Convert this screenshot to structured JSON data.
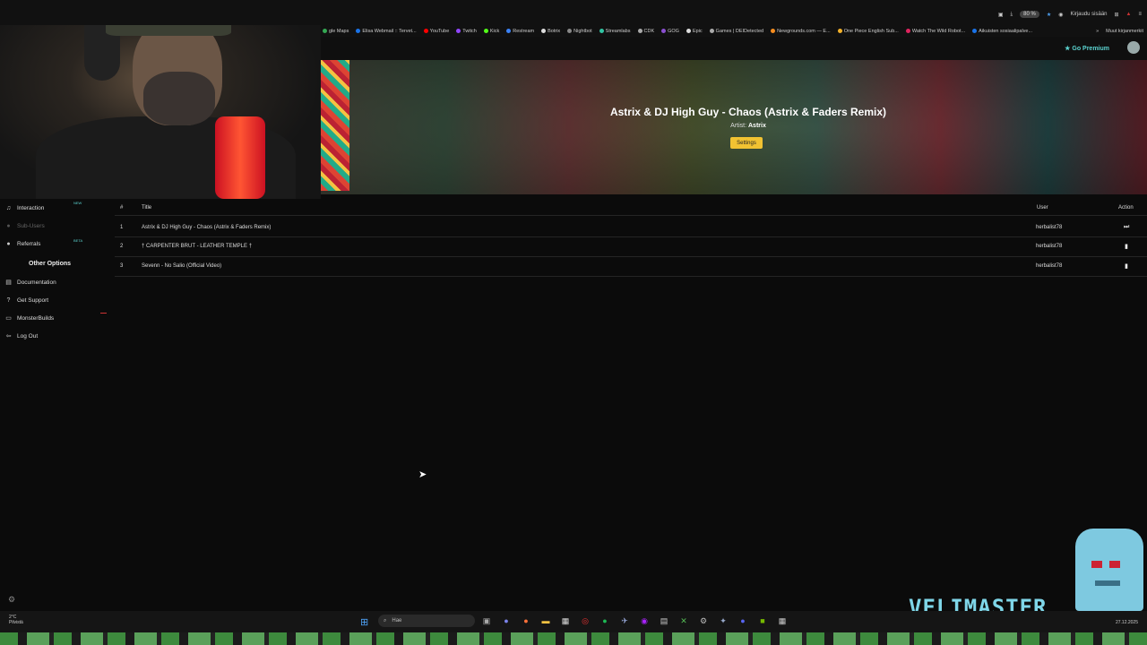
{
  "browser": {
    "zoom": "80 %",
    "signin": "Kirjaudu sisään",
    "bookmarks": [
      {
        "label": "gle Maps",
        "color": "#34a853"
      },
      {
        "label": "Elisa Webmail :: Tervet...",
        "color": "#1a73e8"
      },
      {
        "label": "YouTube",
        "color": "#ff0000"
      },
      {
        "label": "Twitch",
        "color": "#9146ff"
      },
      {
        "label": "Kick",
        "color": "#53fc18"
      },
      {
        "label": "Restream",
        "color": "#3b82f6"
      },
      {
        "label": "Botrix",
        "color": "#ddd"
      },
      {
        "label": "Nightbot",
        "color": "#888"
      },
      {
        "label": "Streamlabs",
        "color": "#31c3a2"
      },
      {
        "label": "CDK",
        "color": "#aaa"
      },
      {
        "label": "GOG",
        "color": "#8a4fd0"
      },
      {
        "label": "Epic",
        "color": "#ddd"
      },
      {
        "label": "Games | DEIDetected",
        "color": "#aaa"
      },
      {
        "label": "Newgrounds.com — E...",
        "color": "#f68d1f"
      },
      {
        "label": "One Piece English Sub...",
        "color": "#f3b12a"
      },
      {
        "label": "Watch The Wild Robot...",
        "color": "#e0245e"
      },
      {
        "label": "Aikuisten sosiaalipalve...",
        "color": "#1a73e8"
      }
    ],
    "other_bookmarks": "Muut kirjanmerkit"
  },
  "appbar": {
    "premium_label": "Go Premium"
  },
  "banner": {
    "song_title": "Astrix & DJ High Guy - Chaos (Astrix & Faders Remix)",
    "artist_label": "Artist:",
    "artist_name": "Astrix",
    "settings_label": "Settings"
  },
  "sidebar": {
    "items": [
      {
        "label": "Interaction",
        "icon": "music-icon",
        "badge": "NEW"
      },
      {
        "label": "Sub-Users",
        "icon": "users-icon"
      },
      {
        "label": "Referrals",
        "icon": "group-icon",
        "badge": "BETA"
      }
    ],
    "section_title": "Other Options",
    "options": [
      {
        "label": "Documentation",
        "icon": "book-icon"
      },
      {
        "label": "Get Support",
        "icon": "question-icon"
      },
      {
        "label": "MonsterBuilds",
        "icon": "monitor-icon"
      },
      {
        "label": "Log Out",
        "icon": "logout-icon"
      }
    ]
  },
  "queue": {
    "headers": {
      "num": "#",
      "title": "Title",
      "user": "User",
      "action": "Action"
    },
    "rows": [
      {
        "num": "1",
        "title": "Astrix & DJ High Guy - Chaos (Astrix & Faders Remix)",
        "user": "herbalist78",
        "action": "skip-icon"
      },
      {
        "num": "2",
        "title": "† CARPENTER BRUT - LEATHER TEMPLE †",
        "user": "herbalist78",
        "action": "trash-icon"
      },
      {
        "num": "3",
        "title": "Sevenn - No Salio (Official Video)",
        "user": "herbalist78",
        "action": "trash-icon"
      }
    ]
  },
  "overlay": {
    "brand": "VELIMASTER"
  },
  "taskbar": {
    "weather_temp": "2°C",
    "weather_desc": "Pilvistä",
    "search_placeholder": "Hae",
    "date": "27.12.2025"
  }
}
